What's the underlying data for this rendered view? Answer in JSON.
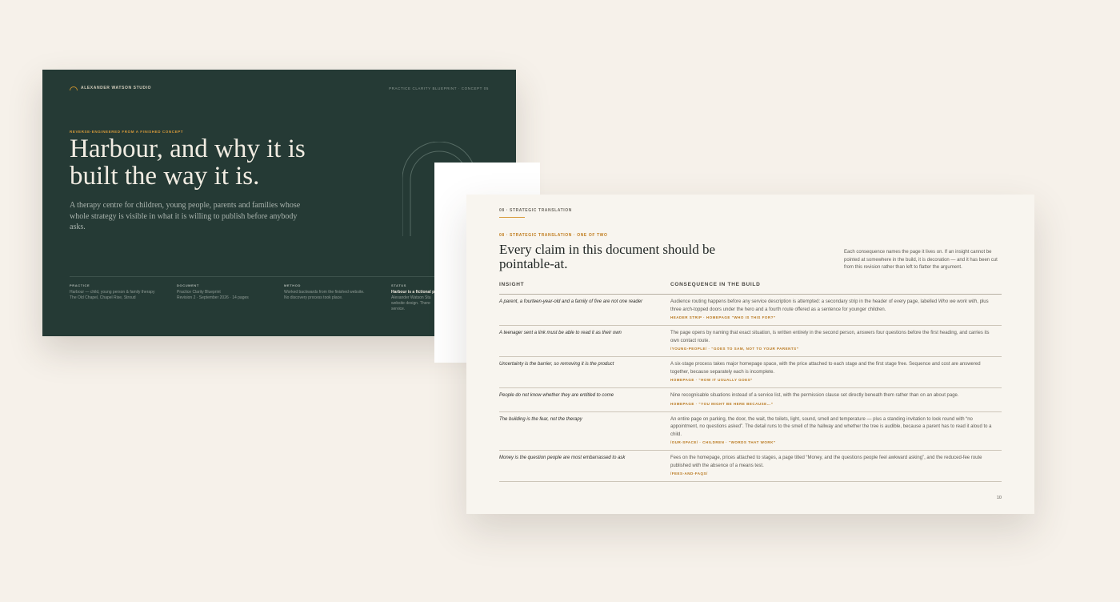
{
  "cover": {
    "brand": "ALEXANDER WATSON STUDIO",
    "doc_tag": "PRACTICE CLARITY BLUEPRINT · CONCEPT 05",
    "eyebrow": "REVERSE-ENGINEERED FROM A FINISHED CONCEPT",
    "title": "Harbour, and why it is built the way it is.",
    "lede": "A therapy centre for children, young people, parents and families whose whole strategy is visible in what it is willing to publish before anybody asks.",
    "facts": [
      {
        "label": "PRACTICE",
        "lines": [
          "Harbour — child, young person & family therapy",
          "The Old Chapel, Chapel Rise, Stroud"
        ]
      },
      {
        "label": "DOCUMENT",
        "lines": [
          "Practice Clarity Blueprint",
          "Revision 2 · September 2026 · 14 pages"
        ]
      },
      {
        "label": "METHOD",
        "lines": [
          "Worked backwards from the finished website.",
          "No discovery process took place."
        ]
      },
      {
        "label": "STATUS",
        "lead": "Harbour is a fictional p",
        "lines": [
          "Alexander Watson Stu",
          "website design. There",
          "service."
        ]
      }
    ]
  },
  "page": {
    "running_head": "08 · STRATEGIC TRANSLATION",
    "eyebrow": "08 · STRATEGIC TRANSLATION · ONE OF TWO",
    "title": "Every claim in this document should be pointable-at.",
    "aside": "Each consequence names the page it lives on. If an insight cannot be pointed at somewhere in the build, it is decoration — and it has been cut from this revision rather than left to flatter the argument.",
    "col_insight": "INSIGHT",
    "col_consequence": "CONSEQUENCE IN THE BUILD",
    "rows": [
      {
        "insight": "A parent, a fourteen-year-old and a family of five are not one reader",
        "consequence_parts": [
          {
            "t": "Audience routing happens before any service description is attempted: a secondary strip in the header of every page, labelled ",
            "i": false
          },
          {
            "t": "Who we work with",
            "i": true
          },
          {
            "t": ", plus three arch-topped doors under the hero and a fourth route offered as a sentence for younger children.",
            "i": false
          }
        ],
        "ref": "HEADER STRIP · HOMEPAGE “WHO IS THIS FOR?”"
      },
      {
        "insight": "A teenager sent a link must be able to read it as their own",
        "consequence_parts": [
          {
            "t": "The page opens by naming that exact situation, is written entirely in the second person, answers four questions before the first heading, and carries its own contact route.",
            "i": false
          }
        ],
        "ref": "/YOUNG-PEOPLE/ · “GOES TO SAM, NOT TO YOUR PARENTS”"
      },
      {
        "insight": "Uncertainty is the barrier, so removing it is the product",
        "consequence_parts": [
          {
            "t": "A six-stage process takes major homepage space, with the price attached to each stage and the first stage free. Sequence and cost are answered together, because separately each is incomplete.",
            "i": false
          }
        ],
        "ref": "HOMEPAGE · “HOW IT USUALLY GOES”"
      },
      {
        "insight": "People do not know whether they are entitled to come",
        "consequence_parts": [
          {
            "t": "Nine recognisable situations instead of a service list, with the permission clause set directly beneath them rather than on an about page.",
            "i": false
          }
        ],
        "ref": "HOMEPAGE · “YOU MIGHT BE HERE BECAUSE…”"
      },
      {
        "insight": "The building is the fear, not the therapy",
        "consequence_parts": [
          {
            "t": "An entire page on parking, the door, the wait, the toilets, light, sound, smell and temperature — plus a standing invitation to look round with “no appointment, no questions asked”. The detail runs to the smell of the hallway and whether the tree is audible, because a parent has to read it aloud to a child.",
            "i": false
          }
        ],
        "ref": "/OUR-SPACE/ · CHILDREN · “WORDS THAT WORK”"
      },
      {
        "insight": "Money is the question people are most embarrassed to ask",
        "consequence_parts": [
          {
            "t": "Fees on the homepage, prices attached to stages, a page titled “Money, and the questions people feel awkward asking”, and the reduced-fee route published ",
            "i": false
          },
          {
            "t": "with",
            "i": true
          },
          {
            "t": " the absence of a means test.",
            "i": false
          }
        ],
        "ref": "/FEES-AND-FAQS/"
      }
    ],
    "folio": "10"
  }
}
